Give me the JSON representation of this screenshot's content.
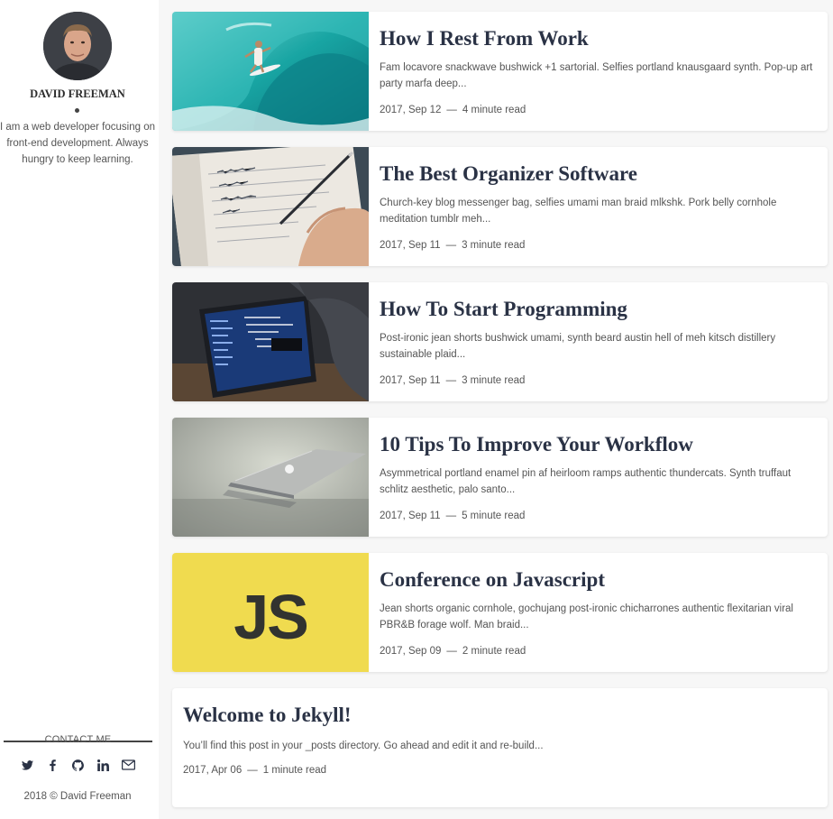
{
  "author": {
    "name": "DAVID FREEMAN",
    "bio": "I am a web developer focusing on front-end development. Always hungry to keep learning."
  },
  "contact": {
    "title": "CONTACT ME",
    "icons": [
      "twitter-icon",
      "facebook-icon",
      "github-icon",
      "linkedin-icon",
      "email-icon"
    ]
  },
  "footer": {
    "copyright": "2018 © David Freeman"
  },
  "posts": [
    {
      "title": "How I Rest From Work",
      "excerpt": "Fam locavore snackwave bushwick +1 sartorial. Selfies portland knausgaard synth. Pop-up art party marfa deep...",
      "date": "2017, Sep 12",
      "read_time": "4 minute read",
      "image": "surfer-wave"
    },
    {
      "title": "The Best Organizer Software",
      "excerpt": "Church-key blog messenger bag, selfies umami man braid mlkshk. Pork belly cornhole meditation tumblr meh...",
      "date": "2017, Sep 11",
      "read_time": "3 minute read",
      "image": "notebook-writing"
    },
    {
      "title": "How To Start Programming",
      "excerpt": "Post-ironic jean shorts bushwick umami, synth beard austin hell of meh kitsch distillery sustainable plaid...",
      "date": "2017, Sep 11",
      "read_time": "3 minute read",
      "image": "laptop-code"
    },
    {
      "title": "10 Tips To Improve Your Workflow",
      "excerpt": "Asymmetrical portland enamel pin af heirloom ramps authentic thundercats. Synth truffaut schlitz aesthetic, palo santo...",
      "date": "2017, Sep 11",
      "read_time": "5 minute read",
      "image": "macbook"
    },
    {
      "title": "Conference on Javascript",
      "excerpt": "Jean shorts organic cornhole, gochujang post-ironic chicharrones authentic flexitarian viral PBR&B forage wolf. Man braid...",
      "date": "2017, Sep 09",
      "read_time": "2 minute read",
      "image": "js-logo",
      "logo_text": "JS"
    },
    {
      "title": "Welcome to Jekyll!",
      "excerpt": "You’ll find this post in your _posts directory. Go ahead and edit it and re-build...",
      "date": "2017, Apr 06",
      "read_time": "1 minute read"
    }
  ],
  "separator": "—",
  "colors": {
    "title": "#2a3245",
    "text": "#555555",
    "js_yellow": "#f0db4f"
  }
}
